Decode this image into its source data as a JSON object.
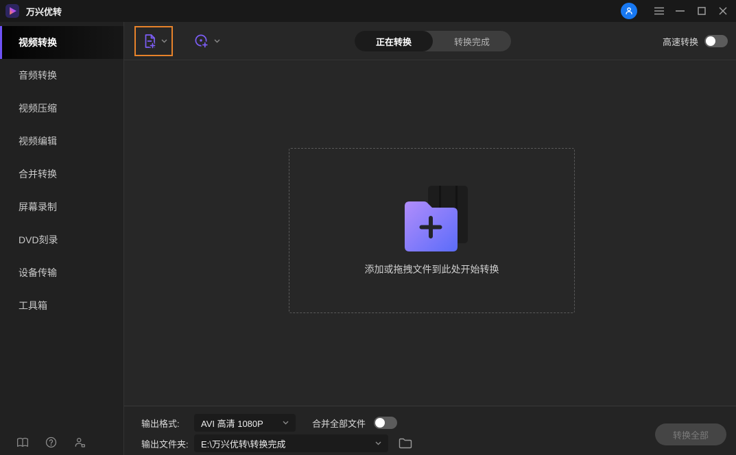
{
  "titlebar": {
    "app_title": "万兴优转"
  },
  "sidebar": {
    "items": [
      {
        "label": "视频转换",
        "active": true
      },
      {
        "label": "音频转换",
        "active": false
      },
      {
        "label": "视频压缩",
        "active": false
      },
      {
        "label": "视频编辑",
        "active": false
      },
      {
        "label": "合并转换",
        "active": false
      },
      {
        "label": "屏幕录制",
        "active": false
      },
      {
        "label": "DVD刻录",
        "active": false
      },
      {
        "label": "设备传输",
        "active": false
      },
      {
        "label": "工具箱",
        "active": false
      }
    ]
  },
  "toolbar": {
    "tabs": [
      {
        "label": "正在转换",
        "active": true
      },
      {
        "label": "转换完成",
        "active": false
      }
    ],
    "high_speed_label": "高速转换",
    "high_speed_on": false
  },
  "dropzone": {
    "hint": "添加或拖拽文件到此处开始转换"
  },
  "footer": {
    "output_format_label": "输出格式:",
    "output_format_value": "AVI 高清 1080P",
    "merge_label": "合并全部文件",
    "merge_on": false,
    "output_folder_label": "输出文件夹:",
    "output_folder_value": "E:\\万兴优转\\转换完成",
    "convert_all_label": "转换全部",
    "convert_all_enabled": false
  },
  "icons": {
    "toolbar": [
      "add-file-icon",
      "add-disc-icon"
    ],
    "side_footer": [
      "guide-book-icon",
      "help-icon",
      "contact-icon"
    ],
    "titlebar": [
      "account-avatar",
      "menu-icon",
      "minimize-icon",
      "maximize-icon",
      "close-icon"
    ]
  },
  "colors": {
    "accent_purple": "#7b61ff",
    "highlight_orange": "#e8832a",
    "avatar_blue": "#1778f2",
    "folder_gradient_start": "#b18dfb",
    "folder_gradient_end": "#5b6cf9",
    "titlebar_bg": "#191919",
    "sidebar_bg": "#212121",
    "main_bg": "#272727",
    "footer_bg": "#242424"
  }
}
